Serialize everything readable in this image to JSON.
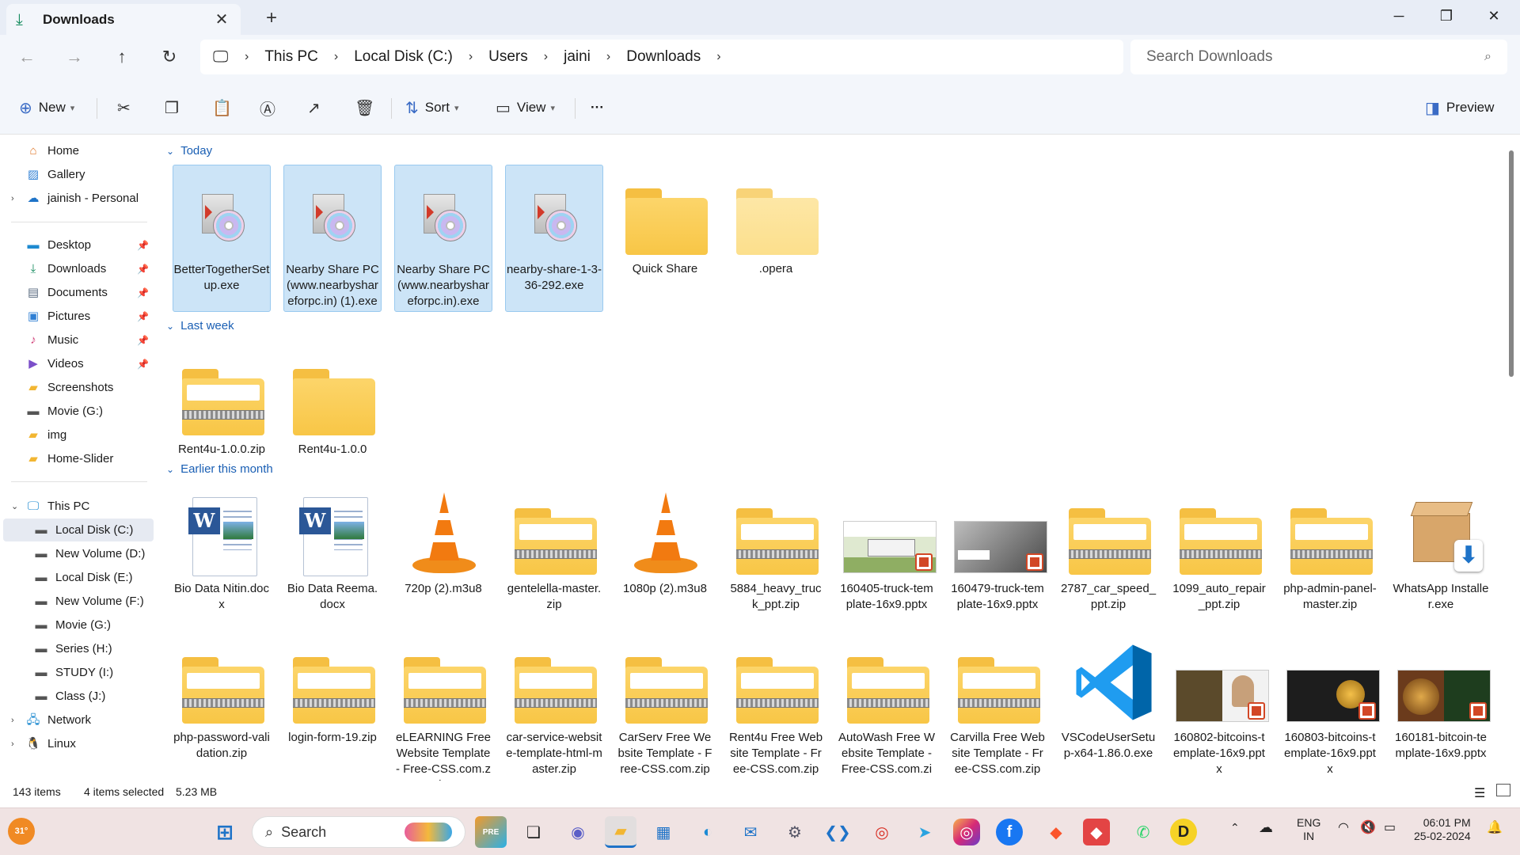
{
  "window": {
    "tab_title": "Downloads",
    "tab_icon": "download-icon",
    "new_tab": "+",
    "controls": [
      "minimize",
      "maximize",
      "close"
    ]
  },
  "nav": {
    "back": "←",
    "forward": "→",
    "up": "↑",
    "refresh": "↻"
  },
  "breadcrumb": [
    "This PC",
    "Local Disk (C:)",
    "Users",
    "jaini",
    "Downloads"
  ],
  "search": {
    "placeholder": "Search Downloads"
  },
  "commands": {
    "new": "New",
    "sort": "Sort",
    "view": "View",
    "more": "···",
    "preview": "Preview"
  },
  "sidebar": {
    "quick": [
      {
        "label": "Home",
        "icon": "home-icon"
      },
      {
        "label": "Gallery",
        "icon": "gallery-icon"
      },
      {
        "label": "jainish - Personal",
        "icon": "onedrive-icon"
      }
    ],
    "pinned": [
      {
        "label": "Desktop",
        "icon": "desktop-icon",
        "pinned": true
      },
      {
        "label": "Downloads",
        "icon": "download-icon",
        "pinned": true
      },
      {
        "label": "Documents",
        "icon": "documents-icon",
        "pinned": true
      },
      {
        "label": "Pictures",
        "icon": "pictures-icon",
        "pinned": true
      },
      {
        "label": "Music",
        "icon": "music-icon",
        "pinned": true
      },
      {
        "label": "Videos",
        "icon": "videos-icon",
        "pinned": true
      },
      {
        "label": "Screenshots",
        "icon": "folder-icon",
        "pinned": false
      },
      {
        "label": "Movie (G:)",
        "icon": "drive-icon",
        "pinned": false
      },
      {
        "label": "img",
        "icon": "folder-icon",
        "pinned": false
      },
      {
        "label": "Home-Slider",
        "icon": "folder-icon",
        "pinned": false
      }
    ],
    "thispc": {
      "label": "This PC",
      "icon": "pc-icon"
    },
    "drives": [
      {
        "label": "Local Disk (C:)",
        "selected": true
      },
      {
        "label": "New Volume (D:)",
        "selected": false
      },
      {
        "label": "Local Disk (E:)",
        "selected": false
      },
      {
        "label": "New Volume (F:)",
        "selected": false
      },
      {
        "label": "Movie (G:)",
        "selected": false
      },
      {
        "label": "Series (H:)",
        "selected": false
      },
      {
        "label": "STUDY (I:)",
        "selected": false
      },
      {
        "label": "Class (J:)",
        "selected": false
      }
    ],
    "network": {
      "label": "Network",
      "icon": "network-icon"
    },
    "linux": {
      "label": "Linux",
      "icon": "linux-icon"
    }
  },
  "groups": {
    "today": "Today",
    "last_week": "Last week",
    "earlier": "Earlier this month"
  },
  "files_today": [
    {
      "name": "BetterTogetherSetup.exe",
      "kind": "exe",
      "selected": true
    },
    {
      "name": "Nearby Share PC (www.nearbyshareforpc.in) (1).exe",
      "kind": "exe",
      "selected": true
    },
    {
      "name": "Nearby Share PC (www.nearbyshareforpc.in).exe",
      "kind": "exe",
      "selected": true
    },
    {
      "name": "nearby-share-1-3-36-292.exe",
      "kind": "exe",
      "selected": true
    },
    {
      "name": "Quick Share",
      "kind": "folder",
      "selected": false
    },
    {
      "name": ".opera",
      "kind": "folder-light",
      "selected": false
    }
  ],
  "files_lastweek": [
    {
      "name": "Rent4u-1.0.0.zip",
      "kind": "zip"
    },
    {
      "name": "Rent4u-1.0.0",
      "kind": "folder"
    }
  ],
  "files_earlier_row1": [
    {
      "name": "Bio Data Nitin.docx",
      "kind": "docx"
    },
    {
      "name": "Bio Data Reema.docx",
      "kind": "docx"
    },
    {
      "name": "720p (2).m3u8",
      "kind": "vlc"
    },
    {
      "name": "gentelella-master.zip",
      "kind": "zip"
    },
    {
      "name": "1080p (2).m3u8",
      "kind": "vlc"
    },
    {
      "name": "5884_heavy_truck_ppt.zip",
      "kind": "zip"
    },
    {
      "name": "160405-truck-template-16x9.pptx",
      "kind": "ppt-truck"
    },
    {
      "name": "160479-truck-template-16x9.pptx",
      "kind": "ppt-truck2"
    },
    {
      "name": "2787_car_speed_ppt.zip",
      "kind": "zip"
    },
    {
      "name": "1099_auto_repair_ppt.zip",
      "kind": "zip"
    },
    {
      "name": "php-admin-panel-master.zip",
      "kind": "zip"
    },
    {
      "name": "WhatsApp Installer.exe",
      "kind": "box"
    }
  ],
  "files_earlier_row2": [
    {
      "name": "php-password-validation.zip",
      "kind": "zip"
    },
    {
      "name": "login-form-19.zip",
      "kind": "zip"
    },
    {
      "name": "eLEARNING Free Website Template - Free-CSS.com.zip",
      "kind": "zip"
    },
    {
      "name": "car-service-website-template-html-master.zip",
      "kind": "zip"
    },
    {
      "name": "CarServ Free Website Template - Free-CSS.com.zip",
      "kind": "zip"
    },
    {
      "name": "Rent4u Free Website Template - Free-CSS.com.zip",
      "kind": "zip"
    },
    {
      "name": "AutoWash Free Website Template - Free-CSS.com.zip",
      "kind": "zip"
    },
    {
      "name": "Carvilla Free Website Template - Free-CSS.com.zip",
      "kind": "zip"
    },
    {
      "name": "VSCodeUserSetup-x64-1.86.0.exe",
      "kind": "vscode"
    },
    {
      "name": "160802-bitcoins-template-16x9.pptx",
      "kind": "ppt-btc1"
    },
    {
      "name": "160803-bitcoins-template-16x9.pptx",
      "kind": "ppt-btc2"
    },
    {
      "name": "160181-bitcoin-template-16x9.pptx",
      "kind": "ppt-btc3"
    }
  ],
  "status": {
    "count": "143 items",
    "selection": "4 items selected",
    "size": "5.23 MB"
  },
  "taskbar": {
    "weather": "31°",
    "search": "Search",
    "lang1": "ENG",
    "lang2": "IN",
    "time": "06:01 PM",
    "date": "25-02-2024"
  },
  "colors": {
    "accent": "#1a5fb4",
    "selected_bg": "#cce4f7",
    "folder": "#f8c646"
  }
}
